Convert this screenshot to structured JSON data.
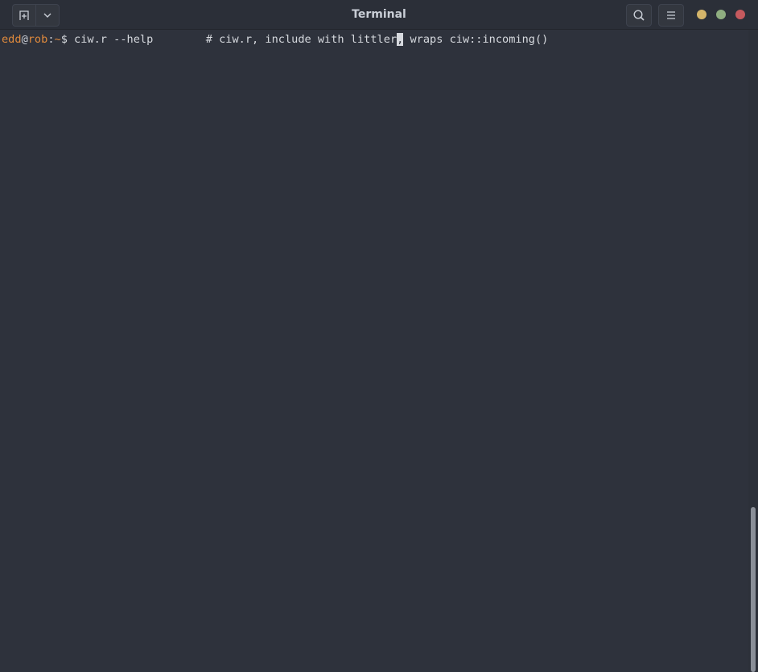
{
  "window": {
    "title": "Terminal"
  },
  "toolbar": {
    "new_tab_icon": "new-tab-icon",
    "dropdown_icon": "chevron-down-icon",
    "search_icon": "search-icon",
    "menu_icon": "hamburger-menu-icon"
  },
  "window_controls": {
    "minimize_color": "#d4b56a",
    "maximize_color": "#8fae80",
    "close_color": "#c65a5e"
  },
  "terminal": {
    "prompt": {
      "user": "edd",
      "at": "@",
      "host": "rob",
      "colon": ":",
      "path": "~",
      "symbol": "$"
    },
    "command_before_cursor": " ciw.r --help        # ciw.r, include with littler",
    "cursor_char": ",",
    "command_after_cursor": " wraps ciw::incoming()"
  },
  "colors": {
    "background": "#2e323c",
    "prompt_accent": "#e08a3c",
    "text": "#d6d9de"
  }
}
